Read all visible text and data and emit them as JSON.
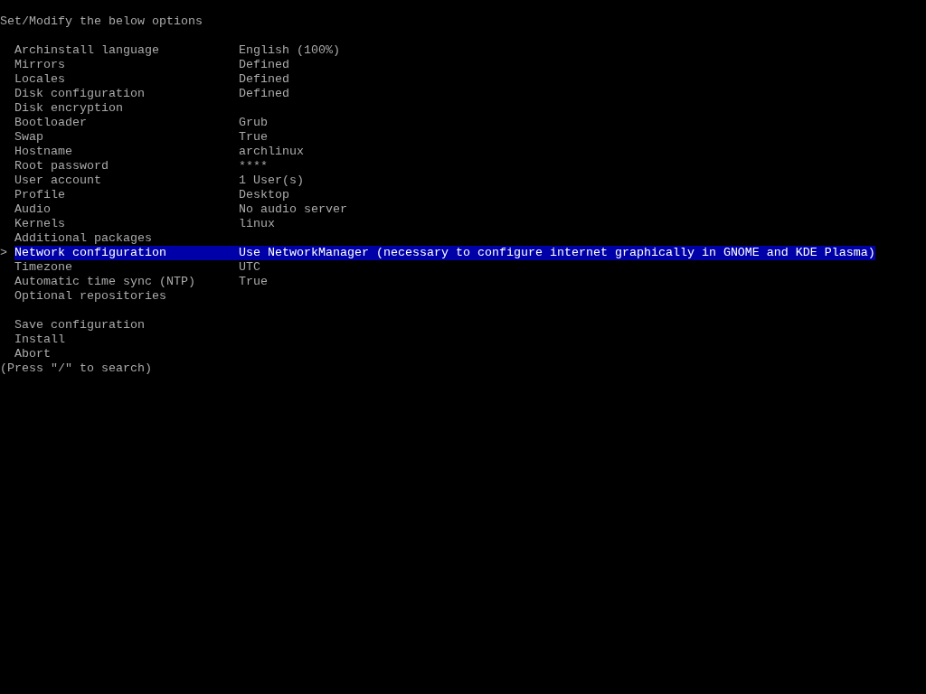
{
  "title": "Set/Modify the below options",
  "cursor": ">",
  "options": [
    {
      "label": "Archinstall language",
      "value": "English (100%)",
      "selected": false
    },
    {
      "label": "Mirrors",
      "value": "Defined",
      "selected": false
    },
    {
      "label": "Locales",
      "value": "Defined",
      "selected": false
    },
    {
      "label": "Disk configuration",
      "value": "Defined",
      "selected": false
    },
    {
      "label": "Disk encryption",
      "selected": false
    },
    {
      "label": "Bootloader",
      "value": "Grub",
      "selected": false
    },
    {
      "label": "Swap",
      "value": "True",
      "selected": false
    },
    {
      "label": "Hostname",
      "value": "archlinux",
      "selected": false
    },
    {
      "label": "Root password",
      "value": "****",
      "selected": false
    },
    {
      "label": "User account",
      "value": "1 User(s)",
      "selected": false
    },
    {
      "label": "Profile",
      "value": "Desktop",
      "selected": false
    },
    {
      "label": "Audio",
      "value": "No audio server",
      "selected": false
    },
    {
      "label": "Kernels",
      "value": "linux",
      "selected": false
    },
    {
      "label": "Additional packages",
      "selected": false
    },
    {
      "label": "Network configuration",
      "value": "Use NetworkManager (necessary to configure internet graphically in GNOME and KDE Plasma)",
      "selected": true
    },
    {
      "label": "Timezone",
      "value": "UTC",
      "selected": false
    },
    {
      "label": "Automatic time sync (NTP)",
      "value": "True",
      "selected": false
    },
    {
      "label": "Optional repositories",
      "selected": false
    }
  ],
  "actions": [
    {
      "label": "Save configuration",
      "selected": false
    },
    {
      "label": "Install",
      "selected": false
    },
    {
      "label": "Abort",
      "selected": false
    }
  ],
  "hint": "(Press \"/\" to search)"
}
